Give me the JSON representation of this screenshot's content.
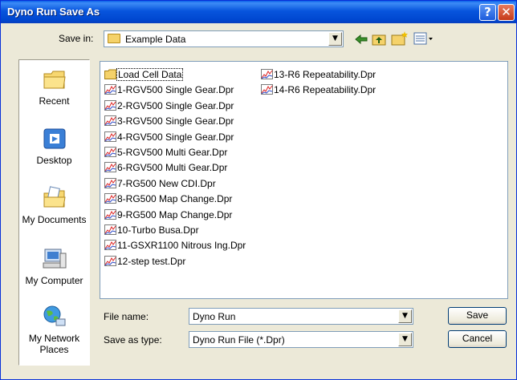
{
  "window": {
    "title": "Dyno Run Save As",
    "help_glyph": "?",
    "close_glyph": "✕"
  },
  "save_in": {
    "label": "Save in:",
    "value": "Example Data"
  },
  "places": [
    {
      "label": "Recent"
    },
    {
      "label": "Desktop"
    },
    {
      "label": "My Documents"
    },
    {
      "label": "My Computer"
    },
    {
      "label": "My Network Places"
    }
  ],
  "files": [
    {
      "name": "Load Cell Data",
      "type": "folder"
    },
    {
      "name": "1-RGV500 Single Gear.Dpr",
      "type": "dpr"
    },
    {
      "name": "2-RGV500 Single Gear.Dpr",
      "type": "dpr"
    },
    {
      "name": "3-RGV500 Single Gear.Dpr",
      "type": "dpr"
    },
    {
      "name": "4-RGV500 Single Gear.Dpr",
      "type": "dpr"
    },
    {
      "name": "5-RGV500 Multi Gear.Dpr",
      "type": "dpr"
    },
    {
      "name": "6-RGV500 Multi Gear.Dpr",
      "type": "dpr"
    },
    {
      "name": "7-RG500 New CDI.Dpr",
      "type": "dpr"
    },
    {
      "name": "8-RG500 Map Change.Dpr",
      "type": "dpr"
    },
    {
      "name": "9-RG500 Map Change.Dpr",
      "type": "dpr"
    },
    {
      "name": "10-Turbo Busa.Dpr",
      "type": "dpr"
    },
    {
      "name": "11-GSXR1100 Nitrous Ing.Dpr",
      "type": "dpr"
    },
    {
      "name": "12-step test.Dpr",
      "type": "dpr"
    },
    {
      "name": "13-R6 Repeatability.Dpr",
      "type": "dpr"
    },
    {
      "name": "14-R6 Repeatability.Dpr",
      "type": "dpr"
    }
  ],
  "file_name": {
    "label": "File name:",
    "value": "Dyno Run"
  },
  "save_as_type": {
    "label": "Save as type:",
    "value": "Dyno Run File (*.Dpr)"
  },
  "buttons": {
    "save": "Save",
    "cancel": "Cancel"
  },
  "colors": {
    "title_bar": "#0054e3",
    "dialog_bg": "#ece9d8",
    "list_border": "#7f9db9"
  }
}
